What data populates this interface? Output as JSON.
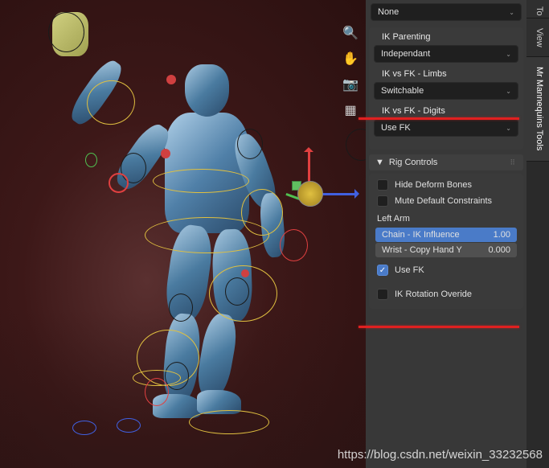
{
  "dropdowns": {
    "top_selected": "None",
    "ik_parenting": {
      "label": "IK Parenting",
      "selected": "Independant"
    },
    "ik_fk_limbs": {
      "label": "IK vs FK - Limbs",
      "selected": "Switchable"
    },
    "ik_fk_digits": {
      "label": "IK vs FK - Digits",
      "selected": "Use FK"
    }
  },
  "section": {
    "rig_controls": "Rig Controls"
  },
  "checkboxes": {
    "hide_deform": {
      "label": "Hide Deform Bones",
      "checked": false
    },
    "mute_constraints": {
      "label": "Mute Default Constraints",
      "checked": false
    },
    "use_fk": {
      "label": "Use FK",
      "checked": true
    },
    "ik_override": {
      "label": "IK Rotation Overide",
      "checked": false
    }
  },
  "limb": {
    "name": "Left Arm"
  },
  "sliders": {
    "chain_ik": {
      "label": "Chain - IK Influence",
      "value": "1.00"
    },
    "wrist_copy": {
      "label": "Wrist - Copy Hand Y",
      "value": "0.000"
    }
  },
  "tabs": {
    "t0": "To",
    "t1": "View",
    "t2": "Mr Mannequins Tools"
  },
  "watermark": "https://blog.csdn.net/weixin_33232568",
  "toolbar": {
    "zoom": "zoom-icon",
    "pan": "hand-icon",
    "camera": "camera-icon",
    "grid": "grid-icon"
  }
}
